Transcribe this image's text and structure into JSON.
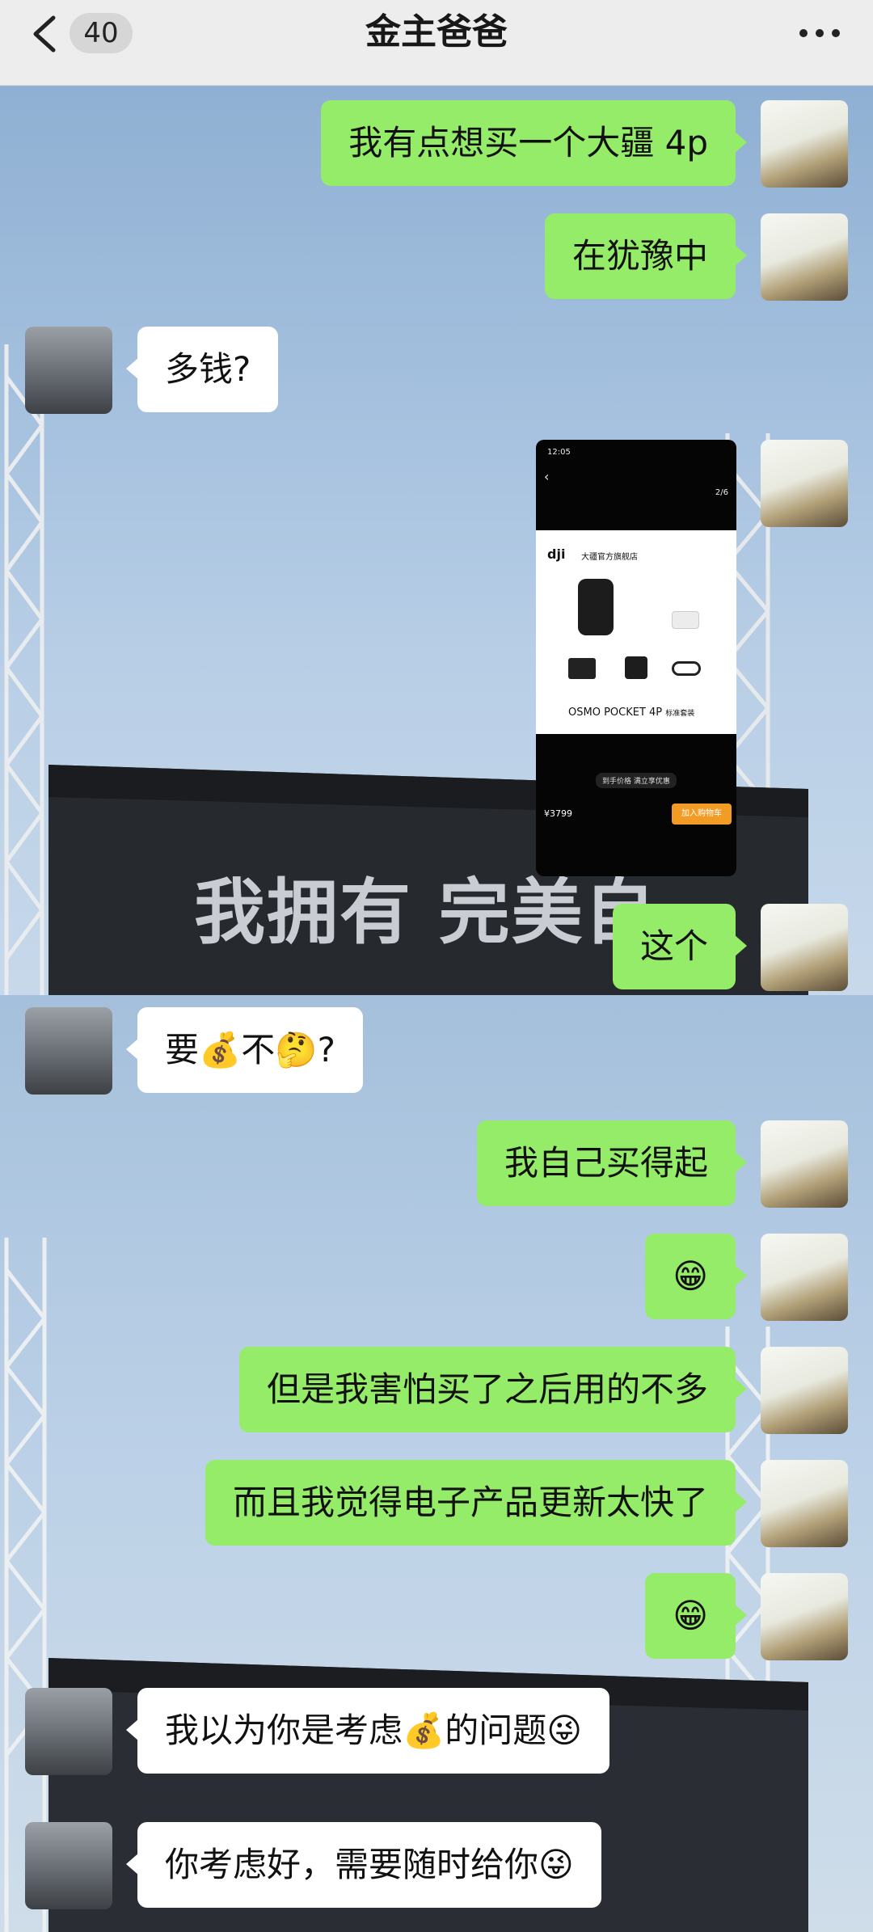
{
  "header": {
    "title": "金主爸爸",
    "unread_count": "40",
    "back_icon": "chevron-left-icon",
    "more_icon": "more-dots-icon"
  },
  "messages": [
    {
      "from": "me",
      "text": "我有点想买一个大疆 4p"
    },
    {
      "from": "me",
      "text": "在犹豫中"
    },
    {
      "from": "peer",
      "text": "多钱?"
    },
    {
      "from": "me",
      "type": "image"
    },
    {
      "from": "me",
      "text": "这个"
    },
    {
      "from": "peer",
      "text": "要💰不🤔?"
    },
    {
      "from": "me",
      "text": "我自己买得起"
    },
    {
      "from": "me",
      "text": "😁"
    },
    {
      "from": "me",
      "text": "但是我害怕买了之后用的不多"
    },
    {
      "from": "me",
      "text": "而且我觉得电子产品更新太快了"
    },
    {
      "from": "me",
      "text": "😁"
    },
    {
      "from": "peer",
      "text": "我以为你是考虑💰的问题😜"
    },
    {
      "from": "peer",
      "text": "你考虑好，需要随时给你😜"
    }
  ],
  "screenshot": {
    "time": "12:05",
    "page": "2/6",
    "store": "大疆官方旗舰店",
    "product": "OSMO POCKET 4P",
    "product_suffix": "标准套装",
    "notice": "到手价格 满立享优惠",
    "price": "¥3799",
    "cart_button": "加入购物车"
  },
  "colors": {
    "my_bubble": "#95ec69",
    "peer_bubble": "#ffffff",
    "header_bg": "#ededed"
  },
  "background": {
    "banner_text": "我拥有 完美自由"
  }
}
